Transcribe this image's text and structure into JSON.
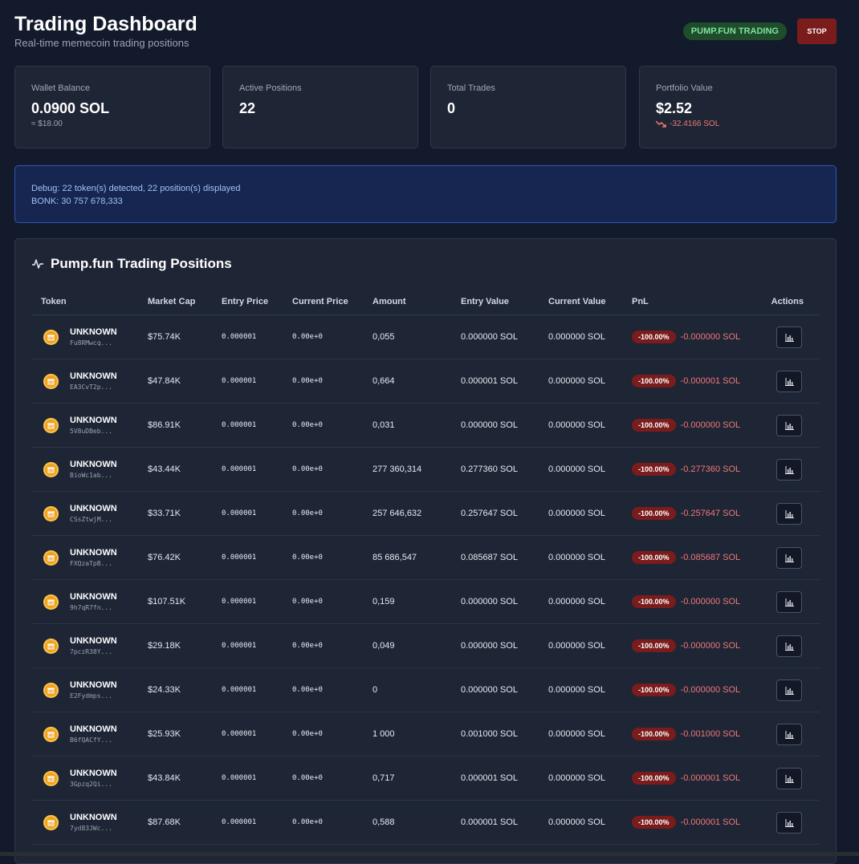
{
  "header": {
    "title": "Trading Dashboard",
    "subtitle": "Real-time memecoin trading positions",
    "mode_badge": "PUMP.FUN TRADING",
    "stop_label": "STOP"
  },
  "stats": [
    {
      "label": "Wallet Balance",
      "value": "0.0900 SOL",
      "sub": "≈ $18.00"
    },
    {
      "label": "Active Positions",
      "value": "22",
      "sub": ""
    },
    {
      "label": "Total Trades",
      "value": "0",
      "sub": ""
    },
    {
      "label": "Portfolio Value",
      "value": "$2.52",
      "sub": "-32.4166 SOL"
    }
  ],
  "debug": {
    "line1": "Debug: 22 token(s) detected, 22 position(s) displayed",
    "line2": "BONK: 30 757 678,333"
  },
  "positions": {
    "title": "Pump.fun Trading Positions",
    "columns": [
      "Token",
      "Market Cap",
      "Entry Price",
      "Current Price",
      "Amount",
      "Entry Value",
      "Current Value",
      "PnL",
      "Actions"
    ],
    "rows": [
      {
        "name": "UNKNOWN",
        "addr": "Fu8RMwcq...",
        "mcap": "$75.74K",
        "entry": "0.000001",
        "current": "0.00e+0",
        "amount": "0,055",
        "entry_value": "0.000000 SOL",
        "current_value": "0.000000 SOL",
        "pnl_pct": "-100.00%",
        "pnl_sol": "-0.000000 SOL"
      },
      {
        "name": "UNKNOWN",
        "addr": "EA3CvT2p...",
        "mcap": "$47.84K",
        "entry": "0.000001",
        "current": "0.00e+0",
        "amount": "0,664",
        "entry_value": "0.000001 SOL",
        "current_value": "0.000000 SOL",
        "pnl_pct": "-100.00%",
        "pnl_sol": "-0.000001 SOL"
      },
      {
        "name": "UNKNOWN",
        "addr": "5V8uDBeb...",
        "mcap": "$86.91K",
        "entry": "0.000001",
        "current": "0.00e+0",
        "amount": "0,031",
        "entry_value": "0.000000 SOL",
        "current_value": "0.000000 SOL",
        "pnl_pct": "-100.00%",
        "pnl_sol": "-0.000000 SOL"
      },
      {
        "name": "UNKNOWN",
        "addr": "BioWc1ab...",
        "mcap": "$43.44K",
        "entry": "0.000001",
        "current": "0.00e+0",
        "amount": "277 360,314",
        "entry_value": "0.277360 SOL",
        "current_value": "0.000000 SOL",
        "pnl_pct": "-100.00%",
        "pnl_sol": "-0.277360 SOL"
      },
      {
        "name": "UNKNOWN",
        "addr": "CSsZtwjM...",
        "mcap": "$33.71K",
        "entry": "0.000001",
        "current": "0.00e+0",
        "amount": "257 646,632",
        "entry_value": "0.257647 SOL",
        "current_value": "0.000000 SOL",
        "pnl_pct": "-100.00%",
        "pnl_sol": "-0.257647 SOL"
      },
      {
        "name": "UNKNOWN",
        "addr": "FXQzaTpB...",
        "mcap": "$76.42K",
        "entry": "0.000001",
        "current": "0.00e+0",
        "amount": "85 686,547",
        "entry_value": "0.085687 SOL",
        "current_value": "0.000000 SOL",
        "pnl_pct": "-100.00%",
        "pnl_sol": "-0.085687 SOL"
      },
      {
        "name": "UNKNOWN",
        "addr": "9h7qR7fn...",
        "mcap": "$107.51K",
        "entry": "0.000001",
        "current": "0.00e+0",
        "amount": "0,159",
        "entry_value": "0.000000 SOL",
        "current_value": "0.000000 SOL",
        "pnl_pct": "-100.00%",
        "pnl_sol": "-0.000000 SOL"
      },
      {
        "name": "UNKNOWN",
        "addr": "7pczR38Y...",
        "mcap": "$29.18K",
        "entry": "0.000001",
        "current": "0.00e+0",
        "amount": "0,049",
        "entry_value": "0.000000 SOL",
        "current_value": "0.000000 SOL",
        "pnl_pct": "-100.00%",
        "pnl_sol": "-0.000000 SOL"
      },
      {
        "name": "UNKNOWN",
        "addr": "E2Fydmps...",
        "mcap": "$24.33K",
        "entry": "0.000001",
        "current": "0.00e+0",
        "amount": "0",
        "entry_value": "0.000000 SOL",
        "current_value": "0.000000 SOL",
        "pnl_pct": "-100.00%",
        "pnl_sol": "-0.000000 SOL"
      },
      {
        "name": "UNKNOWN",
        "addr": "B6fQACfY...",
        "mcap": "$25.93K",
        "entry": "0.000001",
        "current": "0.00e+0",
        "amount": "1 000",
        "entry_value": "0.001000 SOL",
        "current_value": "0.000000 SOL",
        "pnl_pct": "-100.00%",
        "pnl_sol": "-0.001000 SOL"
      },
      {
        "name": "UNKNOWN",
        "addr": "3Gpzq2Qi...",
        "mcap": "$43.84K",
        "entry": "0.000001",
        "current": "0.00e+0",
        "amount": "0,717",
        "entry_value": "0.000001 SOL",
        "current_value": "0.000000 SOL",
        "pnl_pct": "-100.00%",
        "pnl_sol": "-0.000001 SOL"
      },
      {
        "name": "UNKNOWN",
        "addr": "7yd83JWc...",
        "mcap": "$87.68K",
        "entry": "0.000001",
        "current": "0.00e+0",
        "amount": "0,588",
        "entry_value": "0.000001 SOL",
        "current_value": "0.000000 SOL",
        "pnl_pct": "-100.00%",
        "pnl_sol": "-0.000001 SOL"
      }
    ]
  },
  "colors": {
    "background": "#131a2b",
    "card": "#1e2535",
    "negative": "#f07878",
    "badge_green": "#7ee29a",
    "stop_red": "#7a1c1c",
    "coin": "#f0a020"
  },
  "icons": {
    "token": "coin-icon",
    "panel": "activity-icon",
    "action": "bar-chart-icon",
    "portfolio_trend": "trending-down-icon"
  }
}
